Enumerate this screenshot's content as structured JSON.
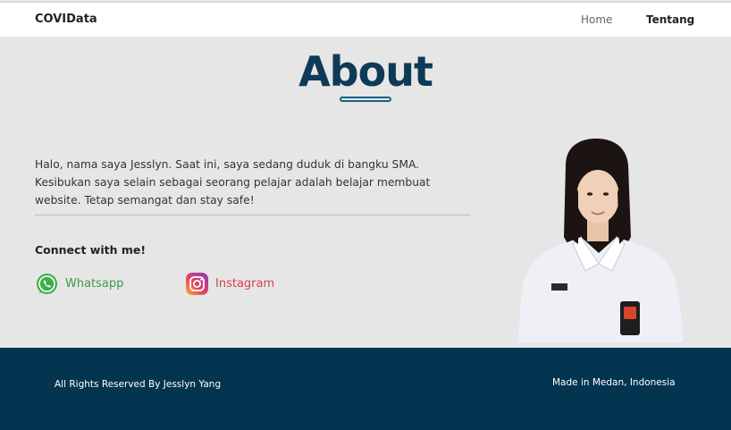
{
  "nav": {
    "brand": "COVIData",
    "items": [
      "Home",
      "Tentang"
    ]
  },
  "about": {
    "title": "About",
    "intro": "Halo, nama saya Jesslyn. Saat ini, saya sedang duduk di bangku SMA. Kesibukan saya selain sebagai seorang pelajar adalah belajar membuat website. Tetap semangat dan stay safe!",
    "connect_heading": "Connect with me!",
    "links": {
      "whatsapp": "Whatsapp",
      "instagram": "Instagram"
    }
  },
  "footer": {
    "left": "All Rights Reserved By Jesslyn Yang",
    "right": "Made in Medan, Indonesia"
  },
  "colors": {
    "title": "#0e3a57",
    "footer_bg": "#043550",
    "whatsapp": "#3e9b4a",
    "instagram": "#d3434f"
  },
  "icons": {
    "whatsapp": "whatsapp-icon",
    "instagram": "instagram-icon"
  }
}
